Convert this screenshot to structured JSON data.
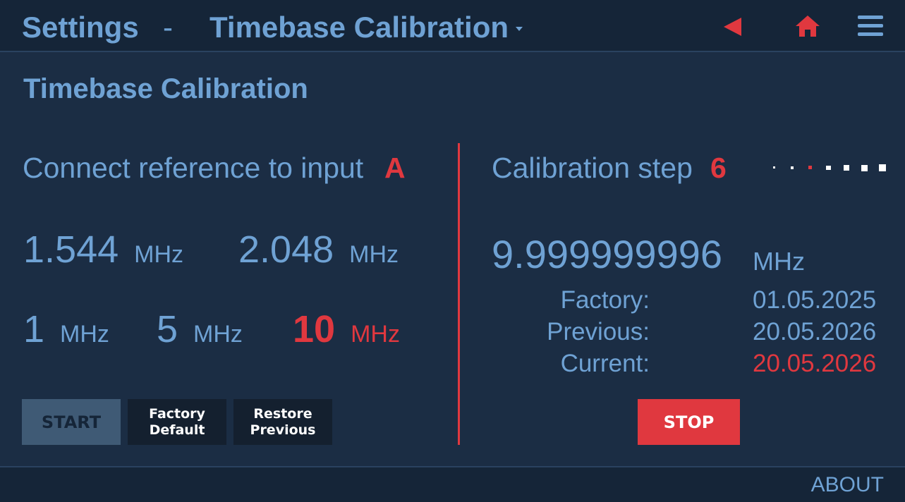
{
  "header": {
    "section": "Settings",
    "separator": "-",
    "page": "Timebase Calibration"
  },
  "title": "Timebase Calibration",
  "instruction": {
    "label": "Connect reference to input",
    "input": "A"
  },
  "frequencies": [
    {
      "value": "1.544",
      "unit": "MHz",
      "selected": false
    },
    {
      "value": "2.048",
      "unit": "MHz",
      "selected": false
    },
    {
      "value": "1",
      "unit": "MHz",
      "selected": false
    },
    {
      "value": "5",
      "unit": "MHz",
      "selected": false
    },
    {
      "value": "10",
      "unit": "MHz",
      "selected": true
    }
  ],
  "buttons": {
    "start": "START",
    "factory_line1": "Factory",
    "factory_line2": "Default",
    "restore_line1": "Restore",
    "restore_line2": "Previous",
    "stop": "STOP"
  },
  "calibration": {
    "step_label": "Calibration step",
    "step": "6",
    "total_steps": 7,
    "reading": "9.999999996",
    "reading_unit": "MHz",
    "dates": [
      {
        "label": "Factory:",
        "value": "01.05.2025",
        "current": false
      },
      {
        "label": "Previous:",
        "value": "20.05.2026",
        "current": false
      },
      {
        "label": "Current:",
        "value": "20.05.2026",
        "current": true
      }
    ]
  },
  "footer": {
    "about": "ABOUT"
  },
  "colors": {
    "background": "#1b2d44",
    "text": "#6fa2d4",
    "accent": "#e0383f"
  },
  "icons": [
    "back-arrow-icon",
    "home-icon",
    "menu-icon",
    "dropdown-caret-icon"
  ]
}
